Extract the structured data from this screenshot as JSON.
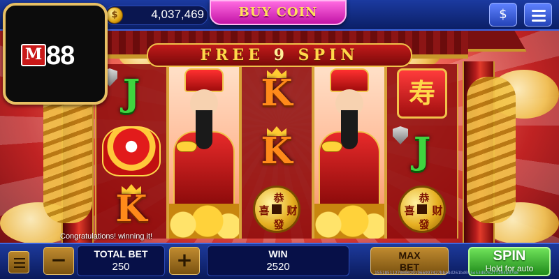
{
  "header": {
    "balance": "4,037,469",
    "coin_symbol": "$",
    "buy_coin_label": "BUY COIN",
    "cashier_icon": "cash-hand-icon",
    "menu_icon": "hamburger-menu-icon"
  },
  "logo": {
    "badge": "M",
    "text": "88"
  },
  "banner": {
    "free": "FREE",
    "count": "9",
    "spin": "SPIN"
  },
  "reels": [
    [
      "J",
      "lion-dance-head",
      "K"
    ],
    [
      "god-of-wealth-wild",
      "god-of-wealth-wild",
      "god-of-wealth-wild"
    ],
    [
      "K",
      "K",
      "gold-coin"
    ],
    [
      "god-of-wealth-wild",
      "god-of-wealth-wild",
      "god-of-wealth-wild"
    ],
    [
      "longevity-symbol",
      "J",
      "gold-coin"
    ]
  ],
  "symbols": {
    "longevity_char": "寿",
    "coin_chars": [
      "恭",
      "喜",
      "财",
      "發"
    ]
  },
  "message": "Congratulations! winning it!",
  "footer": {
    "total_bet_label": "TOTAL BET",
    "total_bet_value": "250",
    "minus_label": "−",
    "plus_label": "+",
    "win_label": "WIN",
    "win_value": "2520",
    "max_bet_line1": "MAX",
    "max_bet_line2": "BET",
    "spin_label": "SPIN",
    "spin_sublabel": "Hold for auto",
    "transaction_id": "15518511270000291966997427bba8d261bd0c5e53d8762ffa04b0786"
  },
  "colors": {
    "topbar": "#0b1f66",
    "buy_coin": "#c214a6",
    "spin": "#1f8a1a",
    "banner_text": "#ffd84a"
  }
}
